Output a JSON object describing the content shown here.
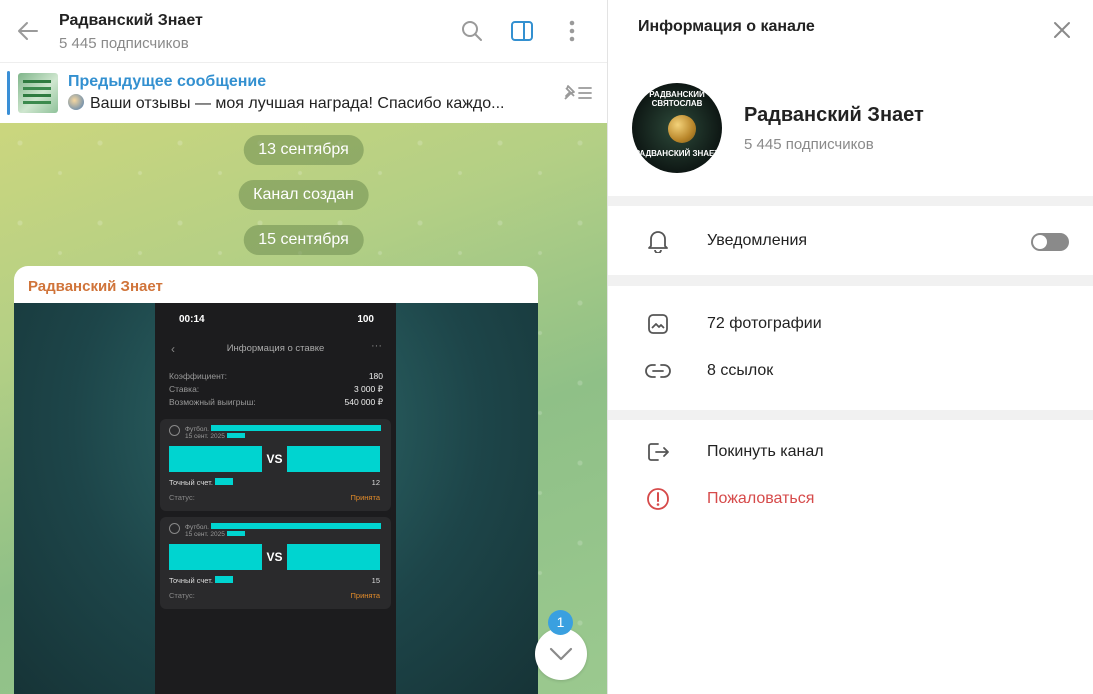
{
  "chat": {
    "title": "Радванский Знает",
    "subscribers": "5 445 подписчиков",
    "pinned": {
      "label": "Предыдущее сообщение",
      "text": "Ваши отзывы — моя лучшая награда! Спасибо каждо..."
    },
    "dates": [
      "13 сентября",
      "Канал создан",
      "15 сентября"
    ],
    "message": {
      "author": "Радванский Знает",
      "screenshot": {
        "time": "00:14",
        "battery": "100",
        "title": "Информация о ставке",
        "rows": [
          {
            "k": "Коэффициент:",
            "v": "180"
          },
          {
            "k": "Ставка:",
            "v": "3 000 ₽"
          },
          {
            "k": "Возможный выигрыш:",
            "v": "540 000 ₽"
          }
        ],
        "cards": [
          {
            "sport": "Футбол.",
            "date": "15 сент. 2025",
            "vs": "VS",
            "bet_label": "Точный счет.",
            "bet_value": "12",
            "status_label": "Статус:",
            "status_value": "Принята"
          },
          {
            "sport": "Футбол.",
            "date": "15 сент. 2025",
            "vs": "VS",
            "bet_label": "Точный счет.",
            "bet_value": "15",
            "status_label": "Статус:",
            "status_value": "Принята"
          }
        ]
      }
    },
    "unread_count": "1"
  },
  "info": {
    "title": "Информация о канале",
    "channel_name": "Радванский Знает",
    "channel_sub": "5 445 подписчиков",
    "avatar_top_text": "РАДВАНСКИЙ СВЯТОСЛАВ",
    "avatar_bottom_text": "РАДВАНСКИЙ ЗНАЕТ",
    "notifications": "Уведомления",
    "notifications_on": false,
    "photos": "72 фотографии",
    "links": "8 ссылок",
    "leave": "Покинуть канал",
    "report": "Пожаловаться"
  },
  "colors": {
    "accent": "#3390d0",
    "author": "#d0743a",
    "danger": "#d64a4a",
    "teal": "#00d4d0"
  }
}
